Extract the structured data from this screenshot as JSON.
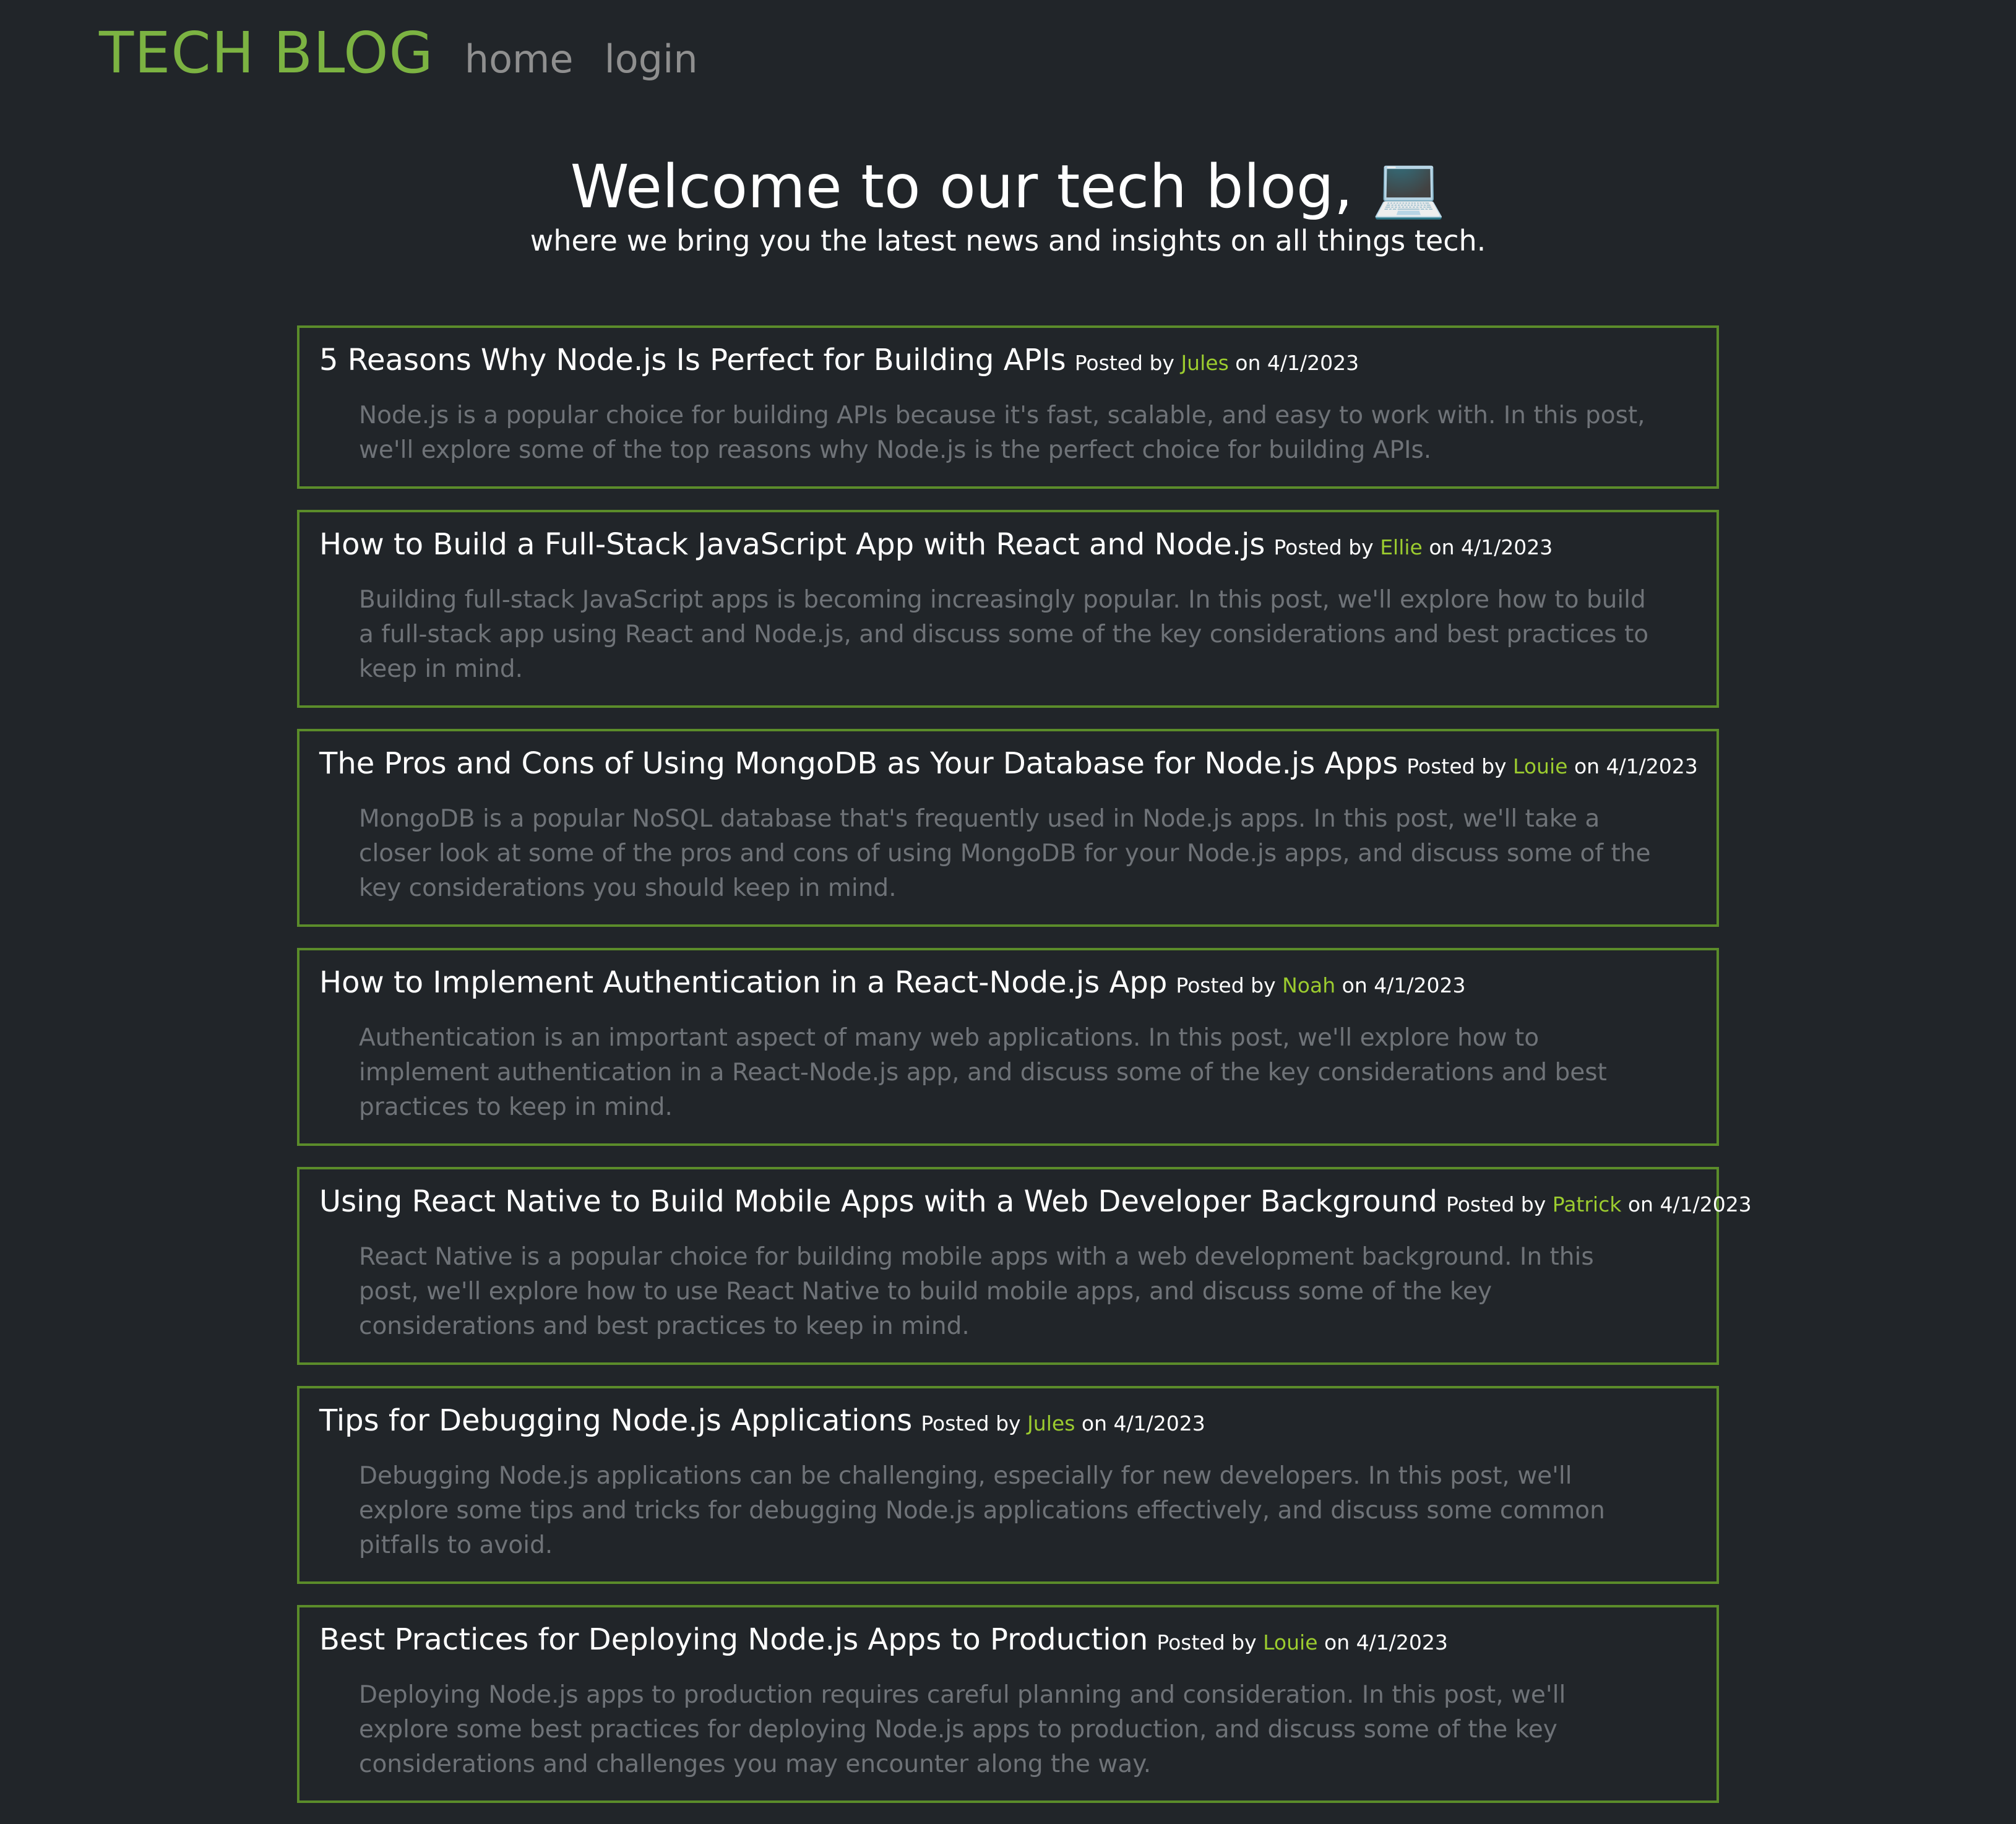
{
  "nav": {
    "brand": "TECH BLOG",
    "links": [
      "home",
      "login"
    ]
  },
  "hero": {
    "title": "Welcome to our tech blog, 💻",
    "subtitle": "where we bring you the latest news and insights on all things tech."
  },
  "posts": [
    {
      "title": "5 Reasons Why Node.js Is Perfect for Building APIs",
      "posted_by": "Posted by",
      "author": "Jules",
      "on": "on",
      "date": "4/1/2023",
      "body": "Node.js is a popular choice for building APIs because it's fast, scalable, and easy to work with. In this post, we'll explore some of the top reasons why Node.js is the perfect choice for building APIs."
    },
    {
      "title": "How to Build a Full-Stack JavaScript App with React and Node.js",
      "posted_by": "Posted by",
      "author": "Ellie",
      "on": "on",
      "date": "4/1/2023",
      "body": "Building full-stack JavaScript apps is becoming increasingly popular. In this post, we'll explore how to build a full-stack app using React and Node.js, and discuss some of the key considerations and best practices to keep in mind."
    },
    {
      "title": "The Pros and Cons of Using MongoDB as Your Database for Node.js Apps",
      "posted_by": "Posted by",
      "author": "Louie",
      "on": "on",
      "date": "4/1/2023",
      "body": "MongoDB is a popular NoSQL database that's frequently used in Node.js apps. In this post, we'll take a closer look at some of the pros and cons of using MongoDB for your Node.js apps, and discuss some of the key considerations you should keep in mind."
    },
    {
      "title": "How to Implement Authentication in a React-Node.js App",
      "posted_by": "Posted by",
      "author": "Noah",
      "on": "on",
      "date": "4/1/2023",
      "body": "Authentication is an important aspect of many web applications. In this post, we'll explore how to implement authentication in a React-Node.js app, and discuss some of the key considerations and best practices to keep in mind."
    },
    {
      "title": "Using React Native to Build Mobile Apps with a Web Developer Background",
      "posted_by": "Posted by",
      "author": "Patrick",
      "on": "on",
      "date": "4/1/2023",
      "body": "React Native is a popular choice for building mobile apps with a web development background. In this post, we'll explore how to use React Native to build mobile apps, and discuss some of the key considerations and best practices to keep in mind."
    },
    {
      "title": "Tips for Debugging Node.js Applications",
      "posted_by": "Posted by",
      "author": "Jules",
      "on": "on",
      "date": "4/1/2023",
      "body": "Debugging Node.js applications can be challenging, especially for new developers. In this post, we'll explore some tips and tricks for debugging Node.js applications effectively, and discuss some common pitfalls to avoid."
    },
    {
      "title": "Best Practices for Deploying Node.js Apps to Production",
      "posted_by": "Posted by",
      "author": "Louie",
      "on": "on",
      "date": "4/1/2023",
      "body": "Deploying Node.js apps to production requires careful planning and consideration. In this post, we'll explore some best practices for deploying Node.js apps to production, and discuss some of the key considerations and challenges you may encounter along the way."
    }
  ]
}
